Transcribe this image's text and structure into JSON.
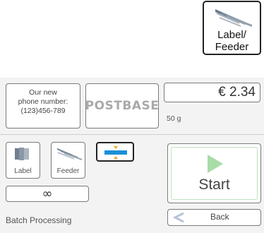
{
  "top": {
    "label_feeder_button": {
      "label_line1": "Label/",
      "label_line2": "Feeder",
      "icon": "label-feeder-icon"
    }
  },
  "info": {
    "line1": "Our new",
    "line2": "phone number:",
    "line3": "(123)456-789"
  },
  "brand": {
    "text": "POSTBASE"
  },
  "postage": {
    "price": "€ 2.34",
    "weight": "50 g"
  },
  "modes": {
    "label": {
      "label": "Label",
      "icon": "label-stack-icon"
    },
    "feeder": {
      "label": "Feeder",
      "icon": "feeder-stack-icon"
    },
    "compact": {
      "icon": "compress-arrows-icon"
    },
    "continuous": {
      "label": "∞"
    }
  },
  "actions": {
    "start": {
      "label": "Start",
      "icon": "play-icon"
    },
    "back": {
      "label": "Back",
      "icon": "back-arrow-icon"
    }
  },
  "status": {
    "text": "Batch Processing"
  },
  "colors": {
    "accent_blue": "#1a8fd6",
    "accent_orange": "#f5a623",
    "play_green": "#a8dca8"
  }
}
